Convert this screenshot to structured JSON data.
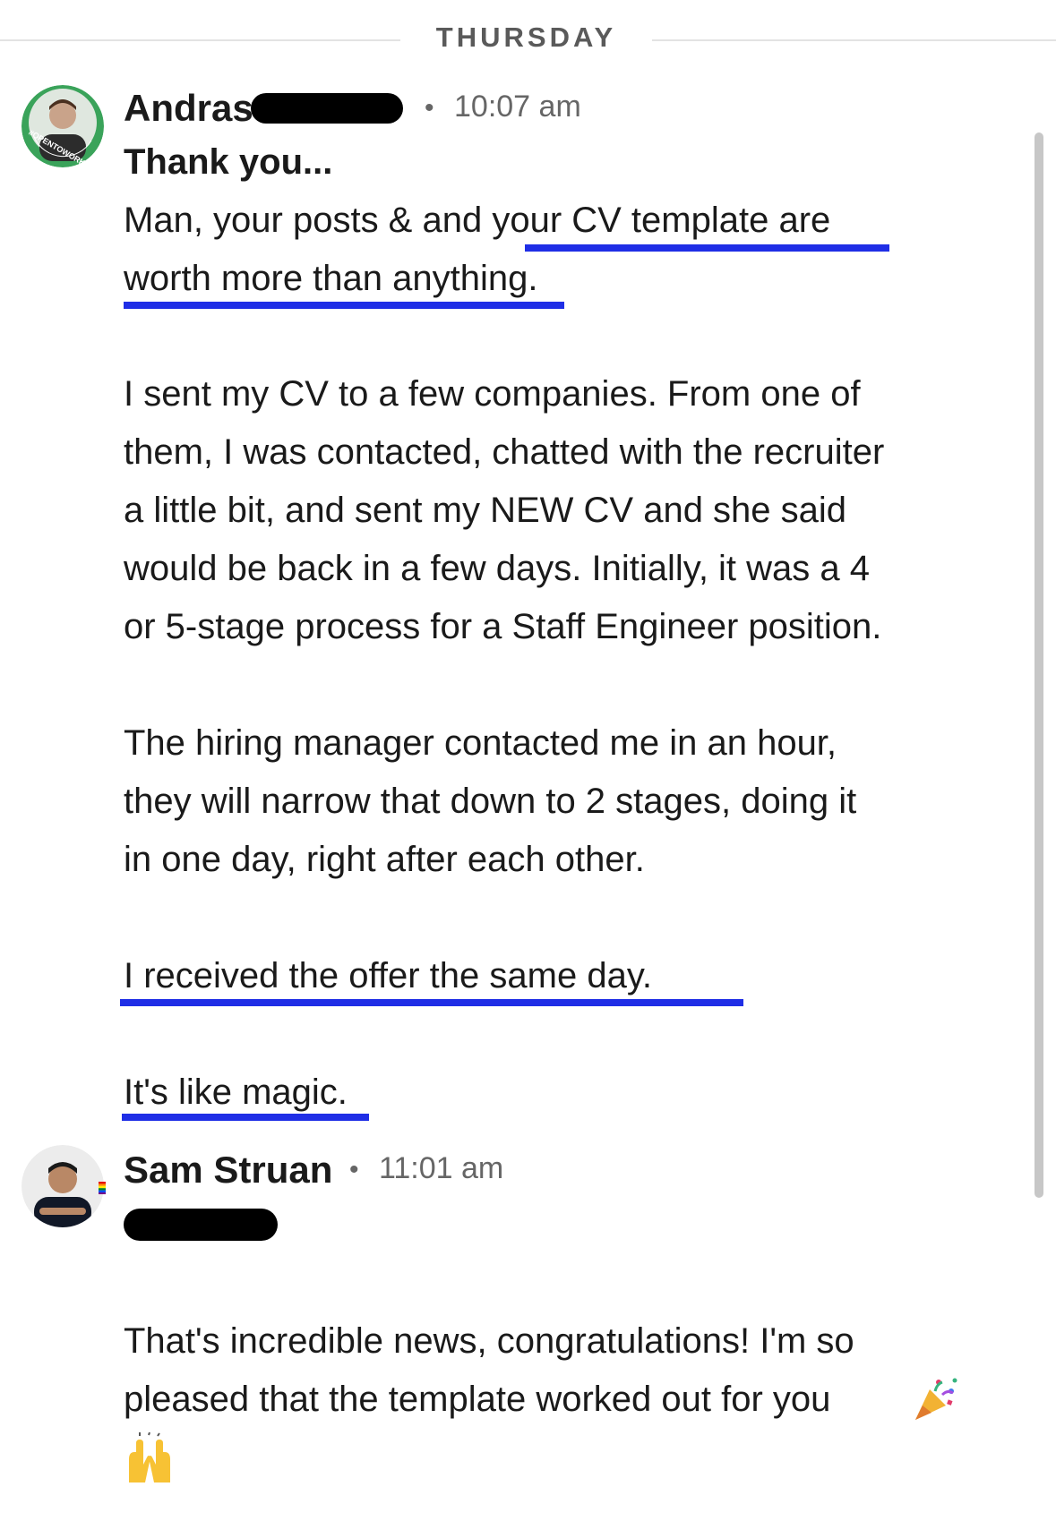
{
  "day_separator": "THURSDAY",
  "messages": [
    {
      "sender": "Andras",
      "time": "10:07 am",
      "subject": "Thank you...",
      "badge": "#OPENTOWORK",
      "lines": [
        "Man, your posts & and your CV template are",
        "worth more than anything.",
        "I sent my CV to a few companies. From one of",
        "them, I was contacted, chatted with the recruiter",
        "a little bit, and sent my NEW CV and she said",
        "would be back in a few days. Initially, it was a 4",
        "or 5-stage process for a Staff Engineer position.",
        "The hiring manager contacted me in an hour,",
        "they will narrow that down to 2 stages, doing it",
        "in one day, right after each other.",
        "I received the offer the same day.",
        "It's like magic."
      ]
    },
    {
      "sender": "Sam Struan",
      "time": "11:01 am",
      "lines": [
        "That's incredible news, congratulations! I'm so",
        "pleased that the template worked out for you"
      ],
      "emojis": [
        "party-popper",
        "raising-hands"
      ]
    }
  ],
  "colors": {
    "underline": "#1f2ee6",
    "badge": "#3aa35a",
    "time": "#666666"
  }
}
